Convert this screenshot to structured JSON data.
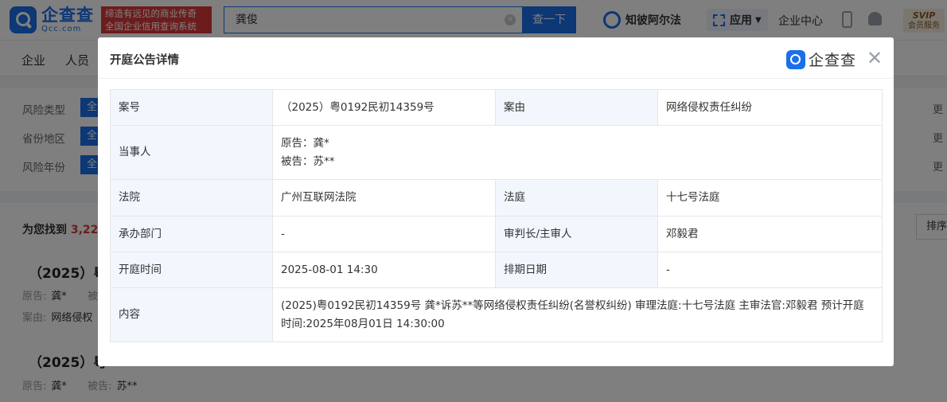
{
  "header": {
    "logo_cn": "企查查",
    "logo_en": "Qcc.com",
    "slogan_line1": "缔造有远见的商业传奇",
    "slogan_line2": "全国企业信用查询系统",
    "search_value": "龚俊",
    "search_button": "查一下",
    "zbaf_label": "知彼阿尔法",
    "apps_label": "应用",
    "enterprise_center": "企业中心",
    "svip_label": "SVIP",
    "svip_sub": "会员服务"
  },
  "tabs": [
    "企业",
    "人员"
  ],
  "filters": [
    {
      "label": "风险类型",
      "pill": "全",
      "more": "更"
    },
    {
      "label": "省份地区",
      "pill": "全",
      "more": "更"
    },
    {
      "label": "风险年份",
      "pill": "全",
      "more": "更"
    }
  ],
  "results": {
    "found_prefix": "为您找到",
    "found_count": "3,22",
    "sort_label": "排序",
    "items": [
      {
        "title": "（2025）粤",
        "plaintiff_label": "原告:",
        "plaintiff": "龚*",
        "defendant_label": "被",
        "defendant": "",
        "cause_label": "案由:",
        "cause": "网络侵权"
      },
      {
        "title": "（2025）粤",
        "plaintiff_label": "原告:",
        "plaintiff": "龚*",
        "defendant_label": "被告:",
        "defendant": "苏**"
      }
    ]
  },
  "modal": {
    "title": "开庭公告详情",
    "logo": "企查查",
    "rows": {
      "case_no_label": "案号",
      "case_no": "（2025）粤0192民初14359号",
      "cause_label": "案由",
      "cause": "网络侵权责任纠纷",
      "party_label": "当事人",
      "plaintiff": "原告：龚*",
      "defendant": "被告：苏**",
      "court_label": "法院",
      "court": "广州互联网法院",
      "tribunal_label": "法庭",
      "tribunal": "十七号法庭",
      "dept_label": "承办部门",
      "dept": "-",
      "judge_label": "审判长/主审人",
      "judge": "邓毅君",
      "time_label": "开庭时间",
      "time": "2025-08-01 14:30",
      "schedule_label": "排期日期",
      "schedule": "-",
      "content_label": "内容",
      "content": "(2025)粤0192民初14359号 龚*诉苏**等网络侵权责任纠纷(名誉权纠纷) 审理法庭:十七号法庭 主审法官:邓毅君 预计开庭时间:2025年08月01日 14:30:00"
    }
  },
  "colors": {
    "brand": "#1a6fea",
    "slogan_bg": "#d93939",
    "label_bg": "#f2f7fe"
  }
}
